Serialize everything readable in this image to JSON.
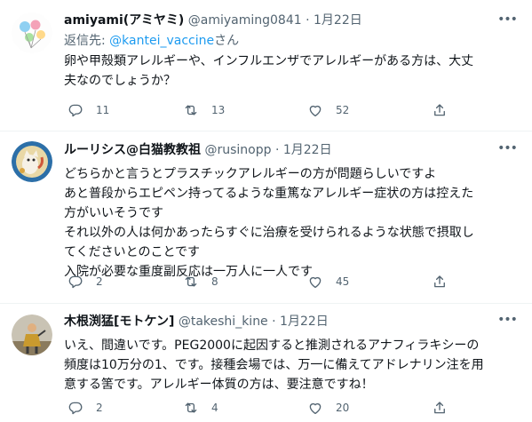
{
  "tweets": [
    {
      "name": "amiyami(アミヤミ)",
      "handle": "@amiyaming0841",
      "sep": "·",
      "date": "1月22日",
      "reply_to_label": "返信先: ",
      "reply_to_user": "@kantei_vaccine",
      "reply_to_suffix": "さん",
      "text": "卵や甲殻類アレルギーや、インフルエンザでアレルギーがある方は、大丈\n夫なのでしょうか？",
      "replies": "11",
      "retweets": "13",
      "likes": "52"
    },
    {
      "name": "ルーリシス@白猫教教祖",
      "handle": "@rusinopp",
      "sep": "·",
      "date": "1月22日",
      "text": "どちらかと言うとプラスチックアレルギーの方が問題らしいですよ\nあと普段からエピペン持ってるような重篤なアレルギー症状の方は控えた\n方がいいそうです\nそれ以外の人は何かあったらすぐに治療を受けられるような状態で摂取し\nてくださいとのことです\n入院が必要な重度副反応は一万人に一人です",
      "replies": "2",
      "retweets": "8",
      "likes": "45"
    },
    {
      "name": "木根渕猛[モトケン]",
      "handle": "@takeshi_kine",
      "sep": "·",
      "date": "1月22日",
      "text": "いえ、間違いです。PEG2000に起因すると推測されるアナフィラキシーの\n頻度は10万分の1、です。接種会場では、万一に備えてアドレナリン注を用\n意する筈です。アレルギー体質の方は、要注意ですね！",
      "replies": "2",
      "retweets": "4",
      "likes": "20"
    }
  ],
  "icons": {
    "reply": "reply-icon",
    "retweet": "retweet-icon",
    "like": "heart-icon",
    "share": "share-icon",
    "more": "more-icon"
  },
  "colors": {
    "text": "#0f1419",
    "secondary": "#536471",
    "link": "#1d9bf0",
    "divider": "#eff3f4"
  }
}
